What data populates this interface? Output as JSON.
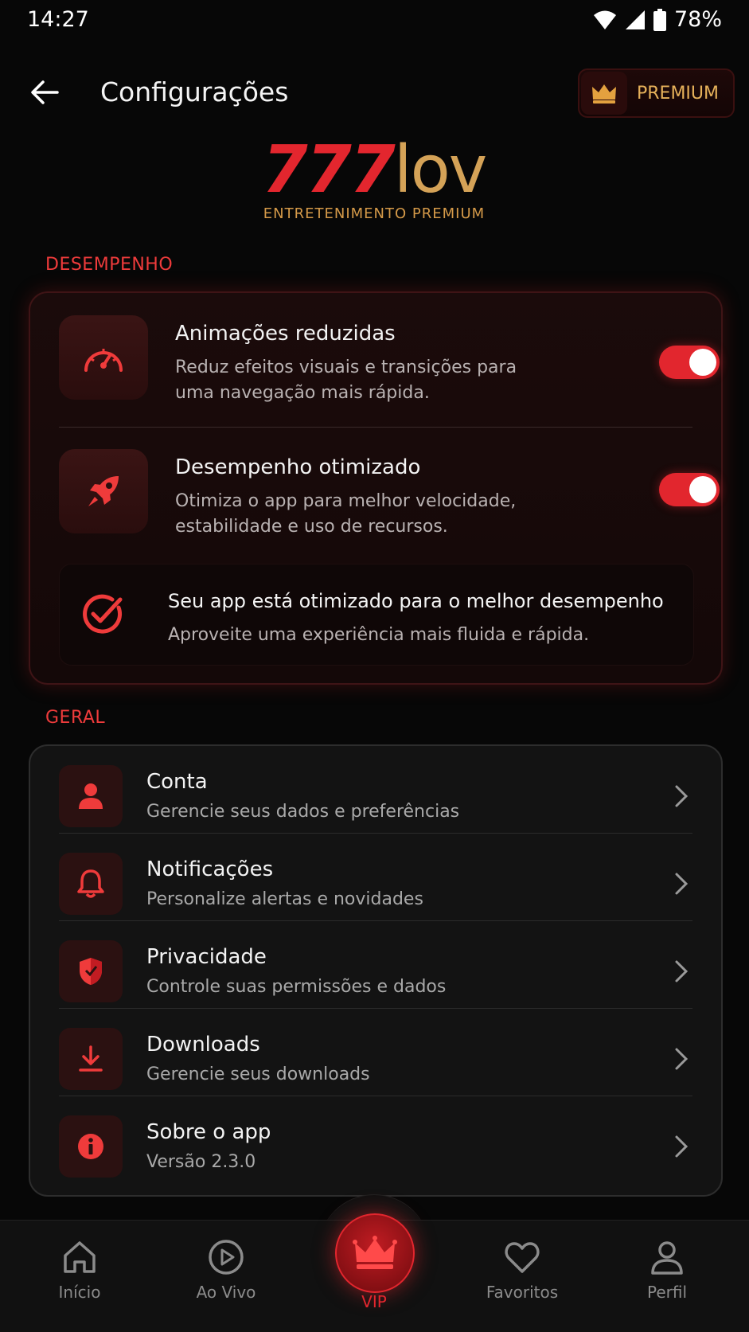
{
  "status_bar": {
    "time": "14:27",
    "battery": "78%"
  },
  "header": {
    "title": "Configurações",
    "premium_label": "PREMIUM"
  },
  "logo": {
    "number": "777",
    "word": "lov",
    "tagline": "ENTRETENIMENTO PREMIUM"
  },
  "performance": {
    "section_label": "DESEMPENHO",
    "items": [
      {
        "title": "Animações reduzidas",
        "description": "Reduz efeitos visuais e transições para uma navegação mais rápida.",
        "enabled": true,
        "icon": "speedometer-icon"
      },
      {
        "title": "Desempenho otimizado",
        "description": "Otimiza o app para melhor velocidade, estabilidade e uso de recursos.",
        "enabled": true,
        "icon": "rocket-icon"
      }
    ],
    "note": {
      "title": "Seu app está otimizado para o melhor desempenho",
      "description": "Aproveite uma experiência mais fluida e rápida.",
      "icon": "check-circle-icon"
    }
  },
  "general": {
    "section_label": "GERAL",
    "items": [
      {
        "title": "Conta",
        "subtitle": "Gerencie seus dados e preferências",
        "icon": "user-icon"
      },
      {
        "title": "Notificações",
        "subtitle": "Personalize alertas e novidades",
        "icon": "bell-icon"
      },
      {
        "title": "Privacidade",
        "subtitle": "Controle suas permissões e dados",
        "icon": "shield-icon"
      },
      {
        "title": "Downloads",
        "subtitle": "Gerencie seus downloads",
        "icon": "download-icon"
      },
      {
        "title": "Sobre o app",
        "subtitle": "Versão 2.3.0",
        "icon": "info-icon"
      }
    ]
  },
  "bottom_nav": {
    "items": [
      {
        "label": "Início",
        "icon": "home-icon"
      },
      {
        "label": "Ao Vivo",
        "icon": "play-circle-icon"
      },
      {
        "label": "VIP",
        "icon": "crown-icon",
        "active": true
      },
      {
        "label": "Favoritos",
        "icon": "heart-icon"
      },
      {
        "label": "Perfil",
        "icon": "person-icon"
      }
    ]
  },
  "colors": {
    "accent": "#e2262e",
    "gold": "#d4a257",
    "background": "#070707"
  }
}
